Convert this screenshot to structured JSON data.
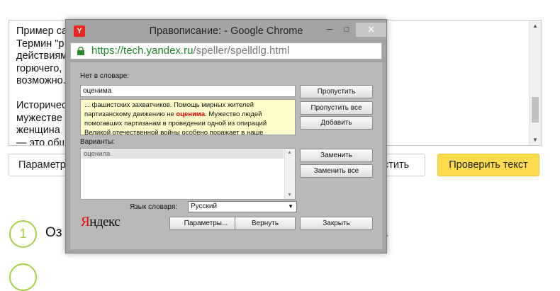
{
  "background": {
    "text_lines": [
      "Пример са                                                          медведев, неисключение.",
      "Термин \"р                                                         Благодаря партизантским",
      "действиям                                                         ачавшегося им вооружения,",
      "горючего,                                                        ей это было бы не",
      "возможно.",
      "",
      "Историчес                                                        жно помнить об отваге и",
      "мужестве                                                          о простых стариках,",
      "женщина                                                          ерритории. Великая Победа",
      "— это общ"
    ],
    "params_button": "Параметр",
    "clear_button": "стить",
    "check_button": "Проверить текст",
    "step1_number": "1",
    "step1_text_left": "Оз",
    "step1_text_right": "."
  },
  "dialog": {
    "title": "Правописание: - Google Chrome",
    "url_host": "https://tech.yandex.ru",
    "url_path": "/speller/spelldlg.html",
    "not_in_dict_label": "Нет в словаре:",
    "word_value": "оценима",
    "context_before": "... фашистских захватчиков. Помощь мирных жителей партизанскому движению не ",
    "context_word": "оценима",
    "context_after": ". Мужество людей помогавших партизанам в проведении одной из опираций Великой отечественной войны особено поражает в наше",
    "variants_label": "Варианты:",
    "variants": [
      "оценила"
    ],
    "language_label": "Язык словаря:",
    "language_value": "Русский",
    "buttons": {
      "skip": "Пропустить",
      "skip_all": "Пропустить все",
      "add": "Добавить",
      "replace": "Заменить",
      "replace_all": "Заменить все",
      "params": "Параметры...",
      "undo": "Вернуть",
      "close": "Закрыть"
    },
    "logo_first": "Я",
    "logo_rest": "ндекс"
  }
}
